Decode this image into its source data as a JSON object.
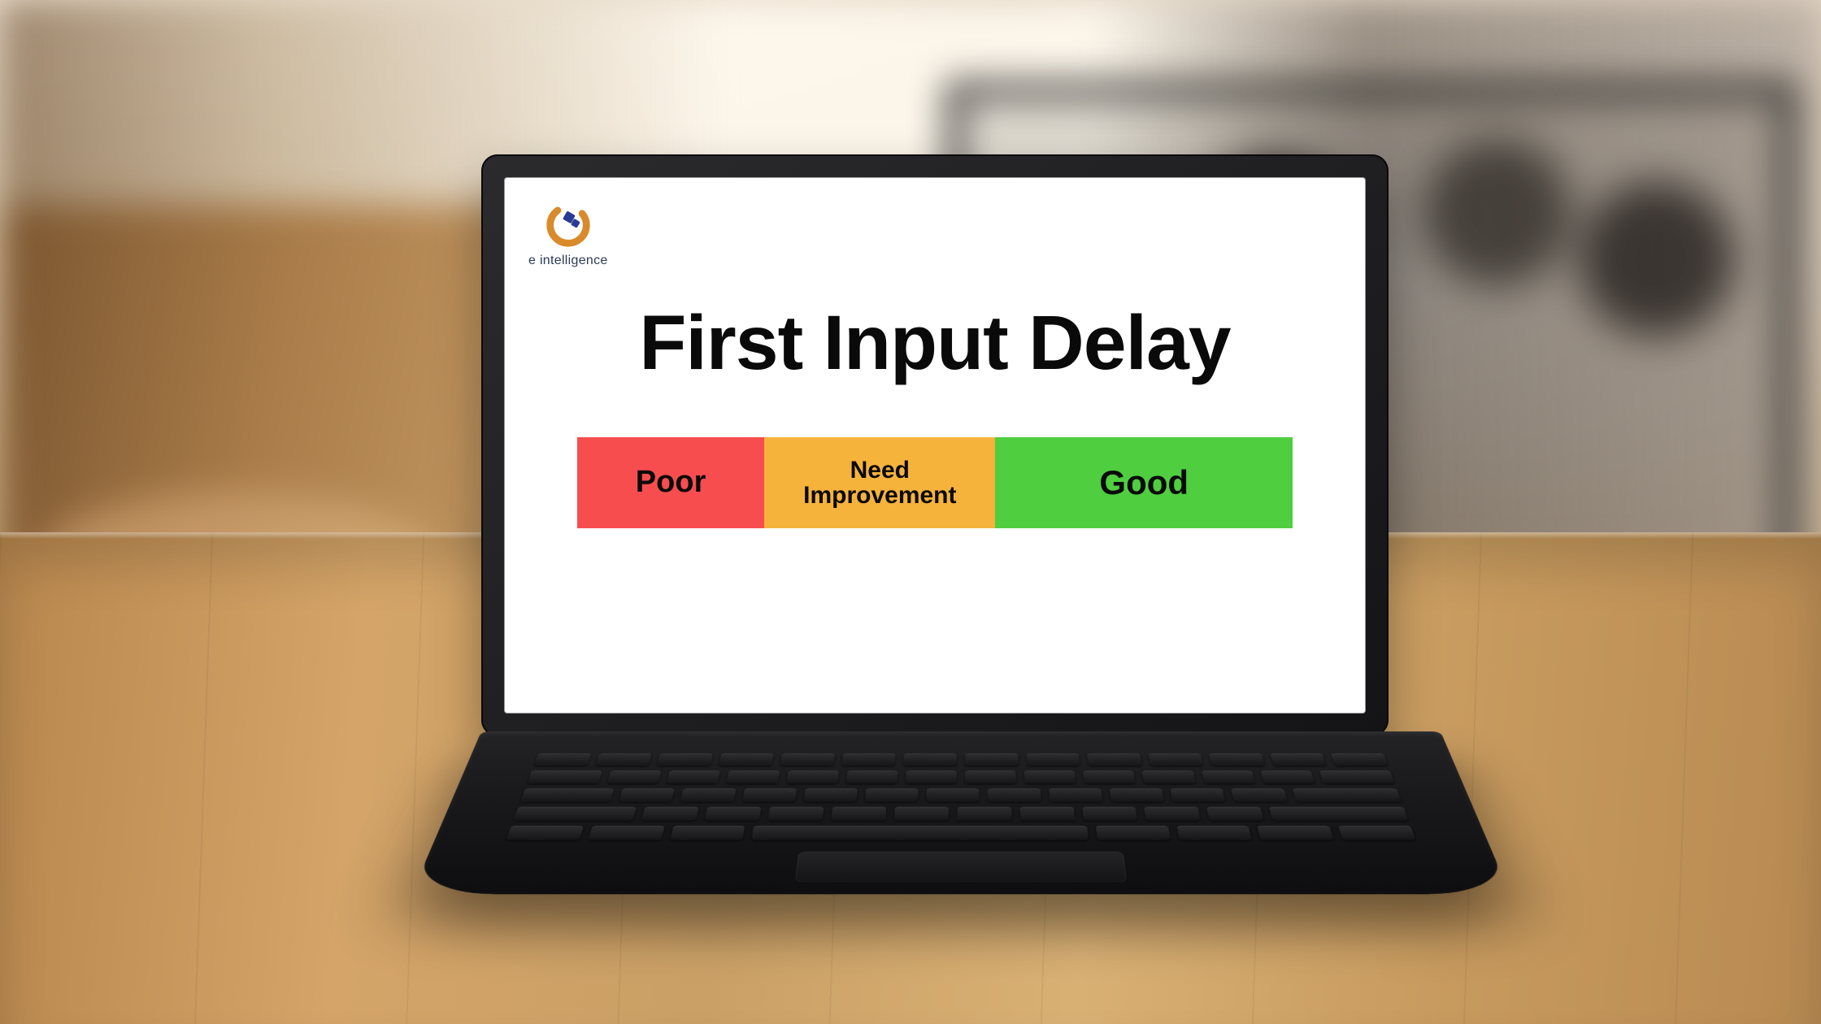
{
  "brand": {
    "name": "e intelligence",
    "logo_colors": {
      "ring": "#d98a2b",
      "accent": "#2b3a95"
    }
  },
  "slide": {
    "title": "First Input Delay",
    "scale": {
      "segments": [
        {
          "label": "Poor",
          "color": "#f84d4f"
        },
        {
          "label_line1": "Need",
          "label_line2": "Improvement",
          "color": "#f6b33c"
        },
        {
          "label": "Good",
          "color": "#4fce3f"
        }
      ]
    }
  }
}
